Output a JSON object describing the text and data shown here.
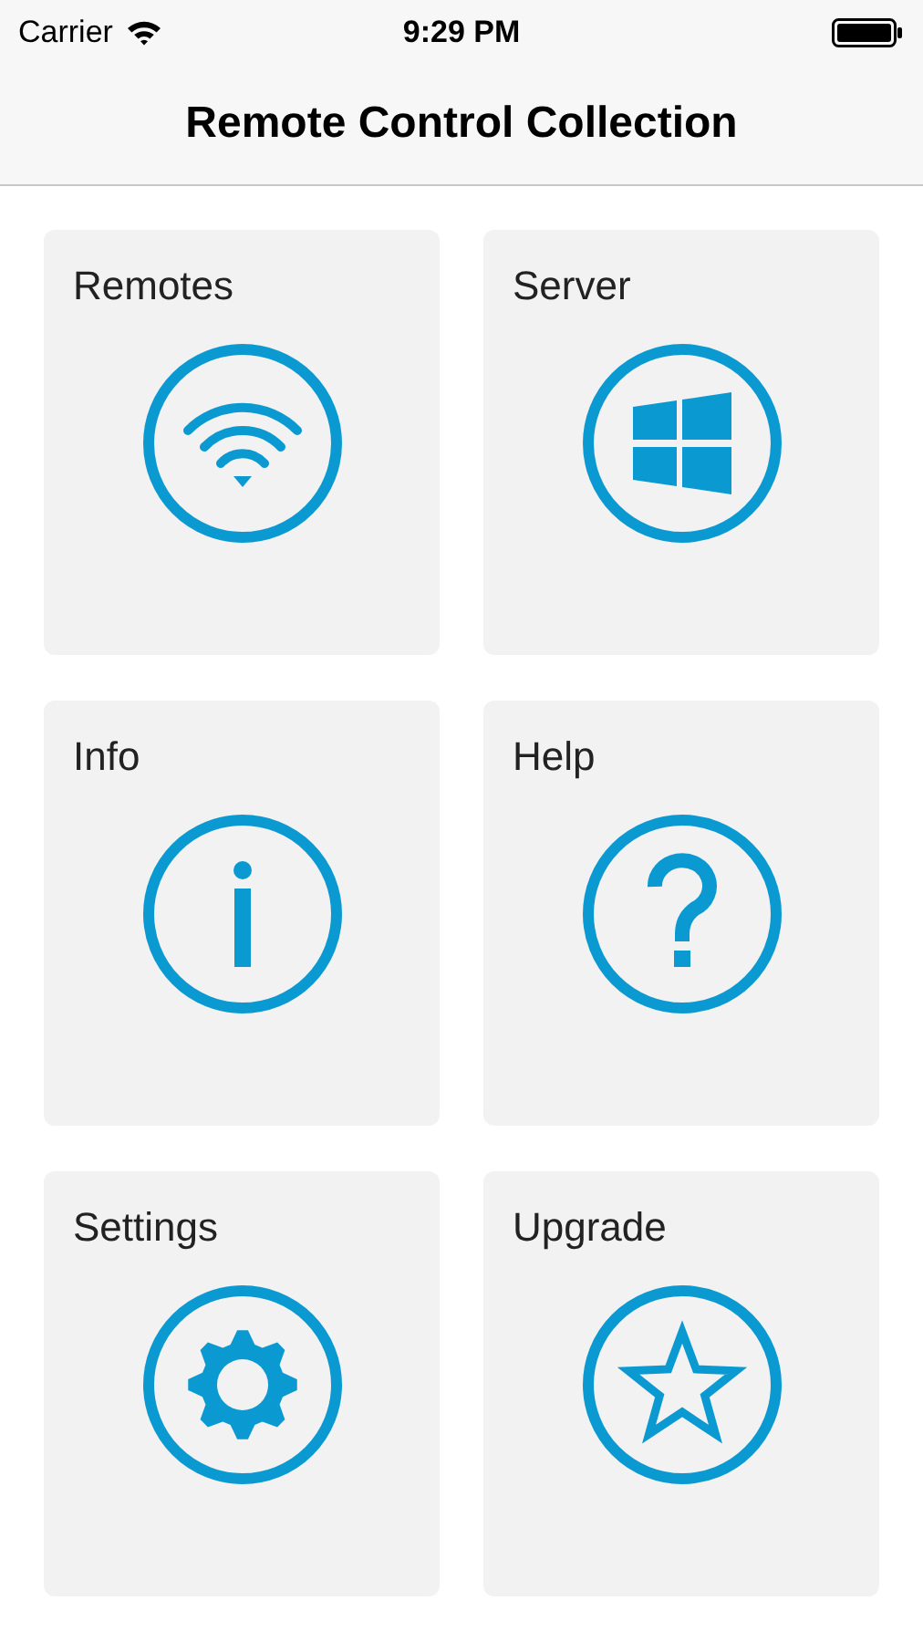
{
  "status_bar": {
    "carrier": "Carrier",
    "time": "9:29 PM"
  },
  "nav_bar": {
    "title": "Remote Control Collection"
  },
  "tiles": [
    {
      "label": "Remotes",
      "kind": "wifi"
    },
    {
      "label": "Server",
      "kind": "windows"
    },
    {
      "label": "Info",
      "kind": "info"
    },
    {
      "label": "Help",
      "kind": "help"
    },
    {
      "label": "Settings",
      "kind": "gear"
    },
    {
      "label": "Upgrade",
      "kind": "star"
    }
  ]
}
